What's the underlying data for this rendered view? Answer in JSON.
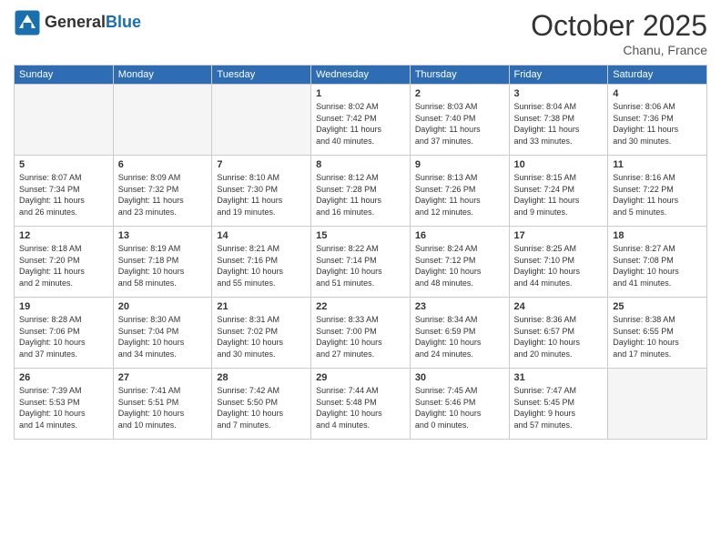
{
  "header": {
    "logo_line1": "General",
    "logo_line2": "Blue",
    "month": "October 2025",
    "location": "Chanu, France"
  },
  "weekdays": [
    "Sunday",
    "Monday",
    "Tuesday",
    "Wednesday",
    "Thursday",
    "Friday",
    "Saturday"
  ],
  "weeks": [
    [
      {
        "num": "",
        "info": "",
        "empty": true
      },
      {
        "num": "",
        "info": "",
        "empty": true
      },
      {
        "num": "",
        "info": "",
        "empty": true
      },
      {
        "num": "1",
        "info": "Sunrise: 8:02 AM\nSunset: 7:42 PM\nDaylight: 11 hours\nand 40 minutes."
      },
      {
        "num": "2",
        "info": "Sunrise: 8:03 AM\nSunset: 7:40 PM\nDaylight: 11 hours\nand 37 minutes."
      },
      {
        "num": "3",
        "info": "Sunrise: 8:04 AM\nSunset: 7:38 PM\nDaylight: 11 hours\nand 33 minutes."
      },
      {
        "num": "4",
        "info": "Sunrise: 8:06 AM\nSunset: 7:36 PM\nDaylight: 11 hours\nand 30 minutes."
      }
    ],
    [
      {
        "num": "5",
        "info": "Sunrise: 8:07 AM\nSunset: 7:34 PM\nDaylight: 11 hours\nand 26 minutes."
      },
      {
        "num": "6",
        "info": "Sunrise: 8:09 AM\nSunset: 7:32 PM\nDaylight: 11 hours\nand 23 minutes."
      },
      {
        "num": "7",
        "info": "Sunrise: 8:10 AM\nSunset: 7:30 PM\nDaylight: 11 hours\nand 19 minutes."
      },
      {
        "num": "8",
        "info": "Sunrise: 8:12 AM\nSunset: 7:28 PM\nDaylight: 11 hours\nand 16 minutes."
      },
      {
        "num": "9",
        "info": "Sunrise: 8:13 AM\nSunset: 7:26 PM\nDaylight: 11 hours\nand 12 minutes."
      },
      {
        "num": "10",
        "info": "Sunrise: 8:15 AM\nSunset: 7:24 PM\nDaylight: 11 hours\nand 9 minutes."
      },
      {
        "num": "11",
        "info": "Sunrise: 8:16 AM\nSunset: 7:22 PM\nDaylight: 11 hours\nand 5 minutes."
      }
    ],
    [
      {
        "num": "12",
        "info": "Sunrise: 8:18 AM\nSunset: 7:20 PM\nDaylight: 11 hours\nand 2 minutes."
      },
      {
        "num": "13",
        "info": "Sunrise: 8:19 AM\nSunset: 7:18 PM\nDaylight: 10 hours\nand 58 minutes."
      },
      {
        "num": "14",
        "info": "Sunrise: 8:21 AM\nSunset: 7:16 PM\nDaylight: 10 hours\nand 55 minutes."
      },
      {
        "num": "15",
        "info": "Sunrise: 8:22 AM\nSunset: 7:14 PM\nDaylight: 10 hours\nand 51 minutes."
      },
      {
        "num": "16",
        "info": "Sunrise: 8:24 AM\nSunset: 7:12 PM\nDaylight: 10 hours\nand 48 minutes."
      },
      {
        "num": "17",
        "info": "Sunrise: 8:25 AM\nSunset: 7:10 PM\nDaylight: 10 hours\nand 44 minutes."
      },
      {
        "num": "18",
        "info": "Sunrise: 8:27 AM\nSunset: 7:08 PM\nDaylight: 10 hours\nand 41 minutes."
      }
    ],
    [
      {
        "num": "19",
        "info": "Sunrise: 8:28 AM\nSunset: 7:06 PM\nDaylight: 10 hours\nand 37 minutes."
      },
      {
        "num": "20",
        "info": "Sunrise: 8:30 AM\nSunset: 7:04 PM\nDaylight: 10 hours\nand 34 minutes."
      },
      {
        "num": "21",
        "info": "Sunrise: 8:31 AM\nSunset: 7:02 PM\nDaylight: 10 hours\nand 30 minutes."
      },
      {
        "num": "22",
        "info": "Sunrise: 8:33 AM\nSunset: 7:00 PM\nDaylight: 10 hours\nand 27 minutes."
      },
      {
        "num": "23",
        "info": "Sunrise: 8:34 AM\nSunset: 6:59 PM\nDaylight: 10 hours\nand 24 minutes."
      },
      {
        "num": "24",
        "info": "Sunrise: 8:36 AM\nSunset: 6:57 PM\nDaylight: 10 hours\nand 20 minutes."
      },
      {
        "num": "25",
        "info": "Sunrise: 8:38 AM\nSunset: 6:55 PM\nDaylight: 10 hours\nand 17 minutes."
      }
    ],
    [
      {
        "num": "26",
        "info": "Sunrise: 7:39 AM\nSunset: 5:53 PM\nDaylight: 10 hours\nand 14 minutes."
      },
      {
        "num": "27",
        "info": "Sunrise: 7:41 AM\nSunset: 5:51 PM\nDaylight: 10 hours\nand 10 minutes."
      },
      {
        "num": "28",
        "info": "Sunrise: 7:42 AM\nSunset: 5:50 PM\nDaylight: 10 hours\nand 7 minutes."
      },
      {
        "num": "29",
        "info": "Sunrise: 7:44 AM\nSunset: 5:48 PM\nDaylight: 10 hours\nand 4 minutes."
      },
      {
        "num": "30",
        "info": "Sunrise: 7:45 AM\nSunset: 5:46 PM\nDaylight: 10 hours\nand 0 minutes."
      },
      {
        "num": "31",
        "info": "Sunrise: 7:47 AM\nSunset: 5:45 PM\nDaylight: 9 hours\nand 57 minutes."
      },
      {
        "num": "",
        "info": "",
        "empty": true
      }
    ]
  ]
}
